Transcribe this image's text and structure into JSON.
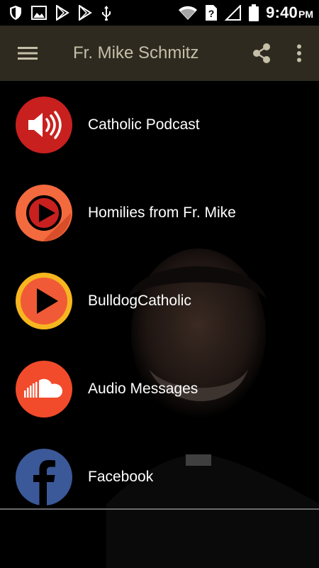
{
  "status_bar": {
    "time": "9:40",
    "ampm": "PM",
    "icons": [
      "shield-icon",
      "image-icon",
      "play-store-icon",
      "play-store-icon",
      "usb-icon",
      "wifi-icon",
      "sim-alert-icon",
      "signal-icon",
      "battery-icon"
    ]
  },
  "app_bar": {
    "title": "Fr. Mike Schmitz",
    "icons": [
      "menu-icon",
      "share-icon",
      "more-vert-icon"
    ]
  },
  "menu": {
    "items": [
      {
        "label": "Catholic Podcast",
        "icon": "speaker-icon",
        "color": "#c8201f"
      },
      {
        "label": "Homilies from Fr. Mike",
        "icon": "play-circle-icon",
        "color": "#f36a3f"
      },
      {
        "label": "BulldogCatholic",
        "icon": "play-icon",
        "color": "#f6b61f"
      },
      {
        "label": "Audio Messages",
        "icon": "soundcloud-icon",
        "color": "#f24b2b"
      },
      {
        "label": "Facebook",
        "icon": "facebook-icon",
        "color": "#3b5998"
      }
    ]
  }
}
